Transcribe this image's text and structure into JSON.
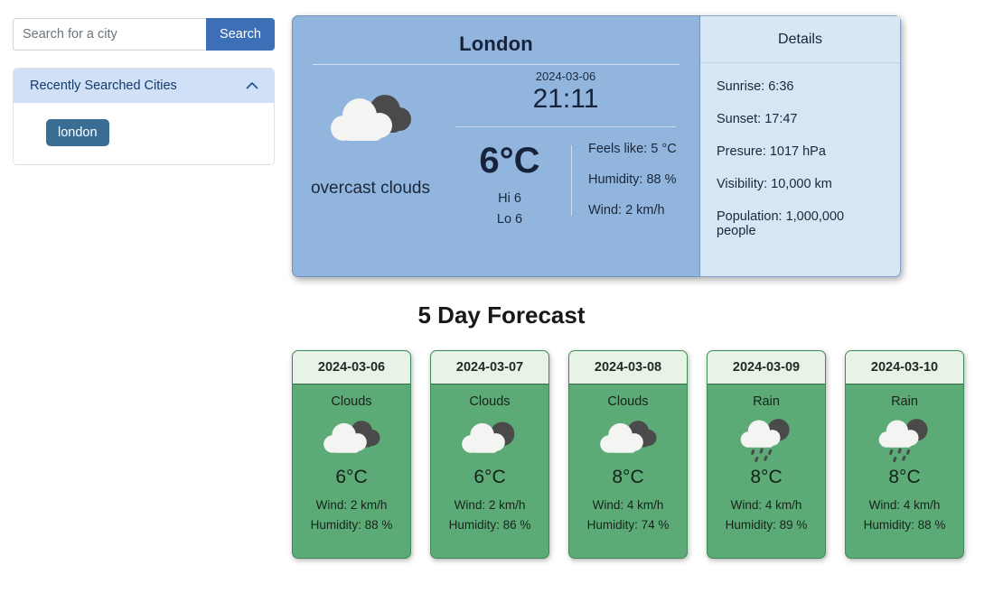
{
  "search": {
    "placeholder": "Search for a city",
    "value": "",
    "button_label": "Search"
  },
  "recent": {
    "title": "Recently Searched Cities",
    "collapse_icon": "chevron-up-icon",
    "cities": [
      "london"
    ]
  },
  "current": {
    "city": "London",
    "date": "2024-03-06",
    "time": "21:11",
    "icon": "overcast-clouds-icon",
    "condition": "overcast clouds",
    "temp": "6°C",
    "hi": "Hi 6",
    "lo": "Lo 6",
    "feels_like": "Feels like: 5 °C",
    "humidity": "Humidity: 88 %",
    "wind": "Wind: 2 km/h"
  },
  "details": {
    "title": "Details",
    "rows": [
      "Sunrise: 6:36",
      "Sunset: 17:47",
      "Presure: 1017 hPa",
      "Visibility: 10,000 km",
      "Population: 1,000,000 people"
    ]
  },
  "forecast": {
    "title": "5 Day Forecast",
    "days": [
      {
        "date": "2024-03-06",
        "condition": "Clouds",
        "icon": "overcast-clouds-icon",
        "temp": "6°C",
        "wind": "Wind: 2 km/h",
        "humidity": "Humidity: 88 %"
      },
      {
        "date": "2024-03-07",
        "condition": "Clouds",
        "icon": "broken-clouds-icon",
        "temp": "6°C",
        "wind": "Wind: 2 km/h",
        "humidity": "Humidity: 86 %"
      },
      {
        "date": "2024-03-08",
        "condition": "Clouds",
        "icon": "overcast-clouds-icon",
        "temp": "8°C",
        "wind": "Wind: 4 km/h",
        "humidity": "Humidity: 74 %"
      },
      {
        "date": "2024-03-09",
        "condition": "Rain",
        "icon": "rain-icon",
        "temp": "8°C",
        "wind": "Wind: 4 km/h",
        "humidity": "Humidity: 89 %"
      },
      {
        "date": "2024-03-10",
        "condition": "Rain",
        "icon": "rain-icon",
        "temp": "8°C",
        "wind": "Wind: 4 km/h",
        "humidity": "Humidity: 88 %"
      }
    ]
  },
  "colors": {
    "accent_blue": "#3c6fb5",
    "chip_blue": "#3a6d94",
    "card_blue": "#92b5de",
    "details_blue": "#d7e6f5",
    "forecast_green": "#5cab77",
    "forecast_head_green": "#e8f3e8"
  }
}
